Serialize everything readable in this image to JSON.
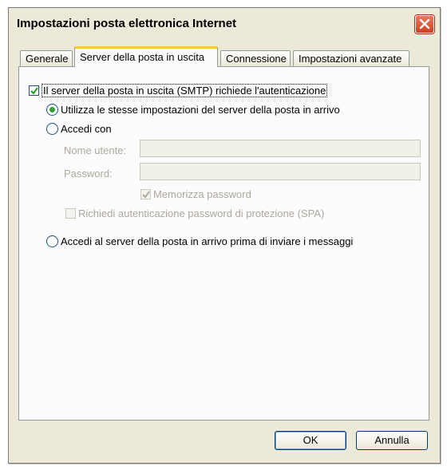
{
  "window": {
    "title": "Impostazioni posta elettronica Internet"
  },
  "tabs": [
    {
      "label": "Generale"
    },
    {
      "label": "Server della posta in uscita"
    },
    {
      "label": "Connessione"
    },
    {
      "label": "Impostazioni avanzate"
    }
  ],
  "smtp_auth": {
    "label": "Il server della posta in uscita (SMTP) richiede l'autenticazione",
    "checked": true
  },
  "options": {
    "same_settings": {
      "label": "Utilizza le stesse impostazioni del server della posta in arrivo",
      "selected": true
    },
    "login_with": {
      "label": "Accedi con",
      "selected": false
    },
    "username_label": "Nome utente:",
    "username_value": "",
    "password_label": "Password:",
    "password_value": "",
    "remember_password": {
      "label": "Memorizza password",
      "checked": true,
      "enabled": false
    },
    "spa": {
      "label": "Richiedi autenticazione password di protezione (SPA)",
      "checked": false,
      "enabled": false
    },
    "login_incoming_first": {
      "label": "Accedi al server della posta in arrivo prima di inviare i messaggi",
      "selected": false
    }
  },
  "buttons": {
    "ok": "OK",
    "cancel": "Annulla"
  },
  "icons": {
    "close": "close-icon",
    "check": "check-icon"
  }
}
